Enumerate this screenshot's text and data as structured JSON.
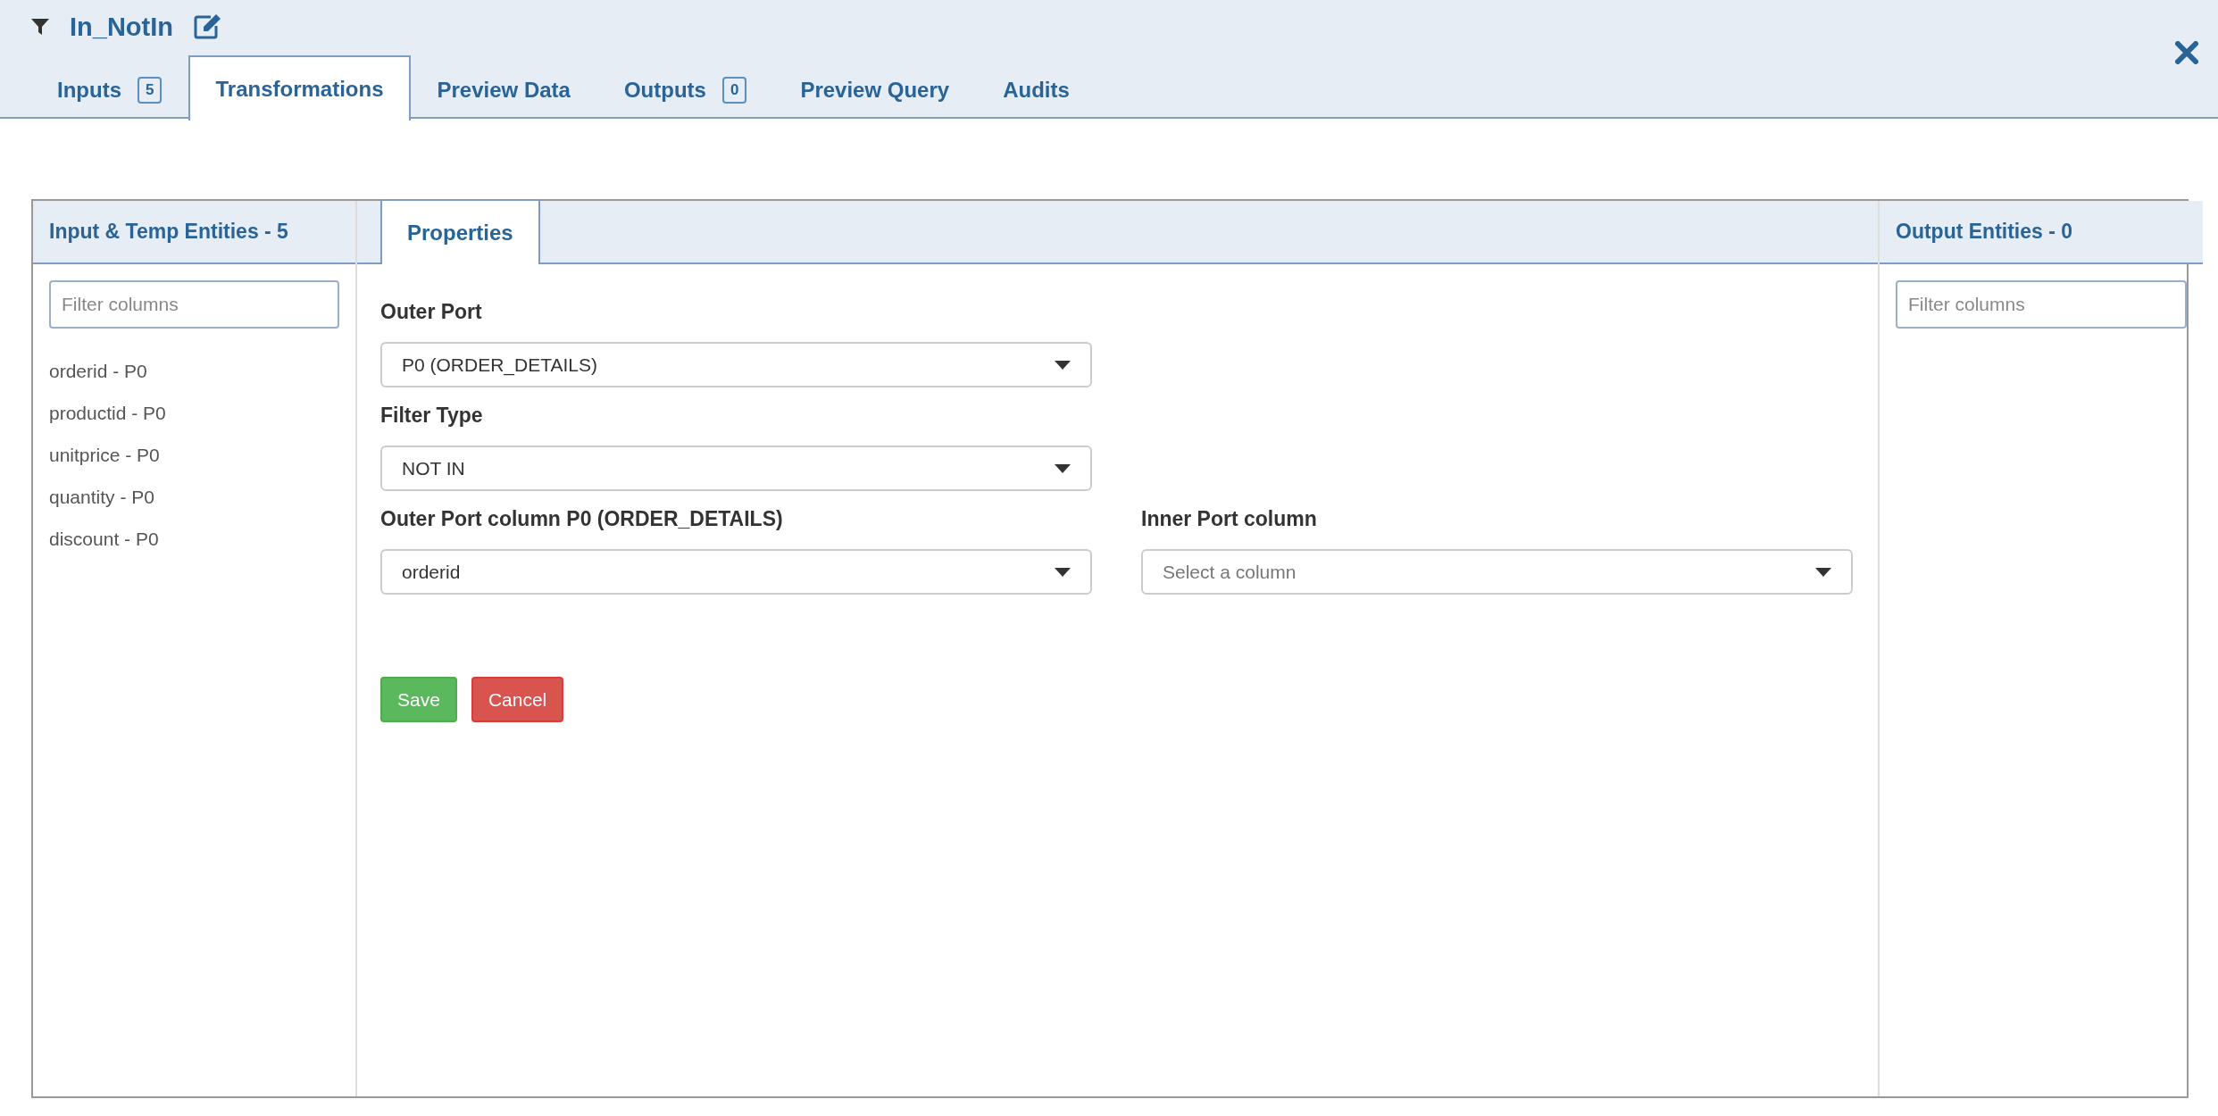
{
  "header": {
    "title": "In_NotIn",
    "tabs": [
      {
        "label": "Inputs",
        "badge": "5",
        "selected": false
      },
      {
        "label": "Transformations",
        "selected": true
      },
      {
        "label": "Preview Data",
        "selected": false
      },
      {
        "label": "Outputs",
        "badge": "0",
        "selected": false
      },
      {
        "label": "Preview Query",
        "selected": false
      },
      {
        "label": "Audits",
        "selected": false
      }
    ]
  },
  "input_panel": {
    "title": "Input & Temp Entities - 5",
    "filter": {
      "placeholder": "Filter columns"
    },
    "columns": [
      "orderid - P0",
      "productid - P0",
      "unitprice - P0",
      "quantity - P0",
      "discount - P0"
    ]
  },
  "properties": {
    "tabs": [
      {
        "label": "Properties",
        "selected": true
      }
    ],
    "rows": [
      [
        {
          "label": "Outer Port",
          "value": "P0 (ORDER_DETAILS)"
        }
      ],
      [
        {
          "label": "Filter Type",
          "value": "NOT IN"
        }
      ],
      [
        {
          "label": "Outer Port column P0 (ORDER_DETAILS)",
          "value": "orderid"
        },
        {
          "label": "Inner Port column",
          "placeholder": "Select a column"
        }
      ]
    ],
    "buttons": [
      {
        "label": "Save",
        "kind": "success"
      },
      {
        "label": "Cancel",
        "kind": "danger"
      }
    ]
  },
  "output_panel": {
    "title": "Output Entities - 0",
    "filter": {
      "placeholder": "Filter columns"
    }
  }
}
